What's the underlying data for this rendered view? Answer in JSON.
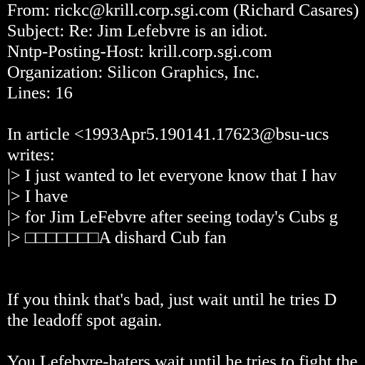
{
  "theme": {
    "background": "#000000",
    "text_color": "#ffffff"
  },
  "lines": [
    "From: rickc@krill.corp.sgi.com (Richard Casares)",
    "Subject: Re: Jim Lefebvre is an idiot.",
    "Nntp-Posting-Host: krill.corp.sgi.com",
    "Organization: Silicon Graphics, Inc.",
    "Lines: 16",
    "",
    "In article <1993Apr5.190141.17623@bsu-ucs",
    "writes:",
    "|> I just wanted to let everyone know that I hav",
    "|> I have",
    "|> for Jim LeFebvre after seeing today's Cubs g",
    "|> □□□□□□□A dishard Cub fan",
    "",
    "",
    "If you think that's bad, just wait until he tries D",
    "the leadoff spot again.",
    "",
    "You Lefebvre-haters wait until he tries to fight the"
  ]
}
